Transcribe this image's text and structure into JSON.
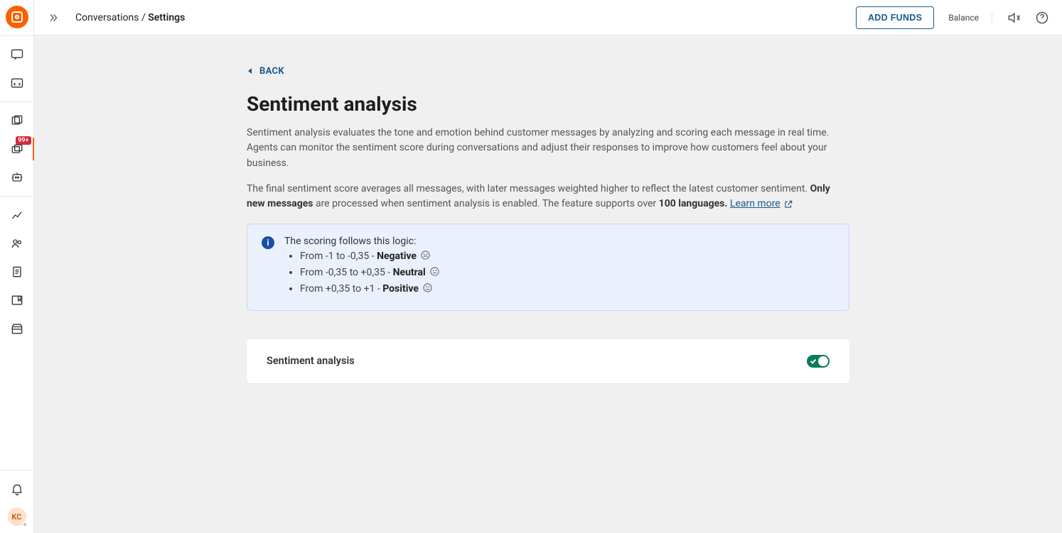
{
  "breadcrumb": {
    "parent": "Conversations",
    "sep": " / ",
    "current": "Settings"
  },
  "header": {
    "add_funds": "ADD FUNDS",
    "balance_label": "Balance"
  },
  "sidebar": {
    "badge": "99+",
    "avatar_initials": "KC"
  },
  "page": {
    "back": "BACK",
    "title": "Sentiment analysis",
    "para1": "Sentiment analysis evaluates the tone and emotion behind customer messages by analyzing and scoring each message in real time. Agents can monitor the sentiment score during conversations and adjust their responses to improve how customers feel about your business.",
    "para2_a": "The final sentiment score averages all messages, with later messages weighted higher to reflect the latest customer sentiment. ",
    "para2_bold1": "Only new messages",
    "para2_b": " are processed when sentiment analysis is enabled. The feature supports over ",
    "para2_bold2": "100 languages.",
    "learn_more": "Learn more"
  },
  "info": {
    "intro": "The scoring follows this logic:",
    "rows": [
      {
        "range": "From -1 to -0,35 - ",
        "label": "Negative"
      },
      {
        "range": "From -0,35 to +0,35 - ",
        "label": "Neutral"
      },
      {
        "range": "From +0,35 to +1 - ",
        "label": "Positive"
      }
    ]
  },
  "card": {
    "title": "Sentiment analysis",
    "toggle_on": true
  }
}
